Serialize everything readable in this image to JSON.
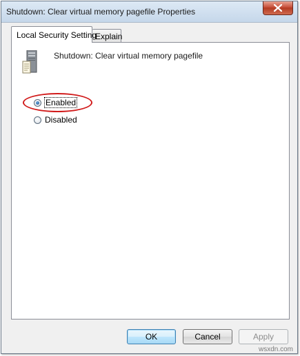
{
  "window": {
    "title": "Shutdown: Clear virtual memory pagefile Properties"
  },
  "tabs": [
    {
      "label": "Local Security Setting",
      "active": true
    },
    {
      "label": "Explain",
      "active": false
    }
  ],
  "policy": {
    "name": "Shutdown: Clear virtual memory pagefile",
    "icon": "server-computer-icon"
  },
  "options": {
    "enabled": {
      "label": "Enabled",
      "accesskey": "E",
      "selected": true
    },
    "disabled": {
      "label": "Disabled",
      "accesskey": "s",
      "selected": false
    }
  },
  "buttons": {
    "ok": "OK",
    "cancel": "Cancel",
    "apply": "Apply"
  },
  "annotation": {
    "color": "#d11a1a"
  },
  "watermark": "wsxdn.com"
}
